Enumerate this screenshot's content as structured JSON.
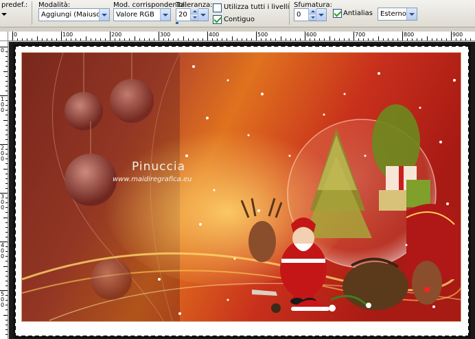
{
  "toolbar": {
    "preset_label": "predef.:",
    "mode_label": "Modalità:",
    "mode_value": "Aggiungi (Maiusc)",
    "match_mode_label": "Mod. corrispondenza:",
    "match_mode_value": "Valore RGB",
    "tolerance_label": "Tolleranza:",
    "tolerance_value": "20",
    "use_all_layers_label": "Utilizza tutti i livelli",
    "contiguous_label": "Contiguo",
    "feather_label": "Sfumatura:",
    "feather_value": "0",
    "antialias_label": "Antialias",
    "antialias_mode_value": "Esterno"
  },
  "checkboxes": {
    "use_all_layers": false,
    "contiguous": true,
    "antialias": true
  },
  "ruler": {
    "top_ticks": [
      "0",
      "100",
      "200",
      "300",
      "400",
      "500",
      "600",
      "700",
      "800",
      "900"
    ],
    "left_ticks": [
      "0",
      "100",
      "200",
      "300",
      "400",
      "500"
    ]
  },
  "image": {
    "watermark_name": "Pinuccia",
    "watermark_url": "www.maidiregrafica.eu"
  },
  "colors": {
    "accent_check": "#21a121",
    "image_red": "#b8221a",
    "image_orange": "#e6761c"
  }
}
